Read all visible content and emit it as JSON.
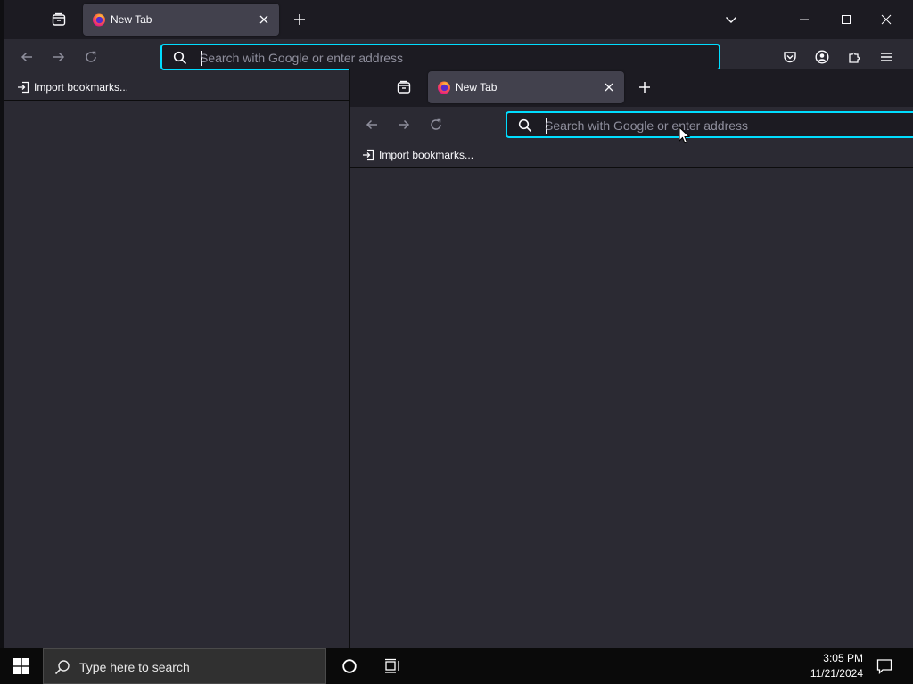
{
  "back_window": {
    "tab": {
      "title": "New Tab"
    },
    "urlbar": {
      "placeholder": "Search with Google or enter address",
      "value": ""
    },
    "bookmarks": {
      "import_label": "Import bookmarks..."
    }
  },
  "front_window": {
    "tab": {
      "title": "New Tab"
    },
    "urlbar": {
      "placeholder": "Search with Google or enter address",
      "value": ""
    },
    "bookmarks": {
      "import_label": "Import bookmarks..."
    }
  },
  "taskbar": {
    "search_placeholder": "Type here to search",
    "time": "3:05 PM",
    "date": "11/21/2024"
  },
  "colors": {
    "accent": "#00ddff",
    "toolbar_bg": "#2b2a33",
    "tabstrip_bg": "#1c1b22",
    "selected_tab": "#42414d"
  }
}
